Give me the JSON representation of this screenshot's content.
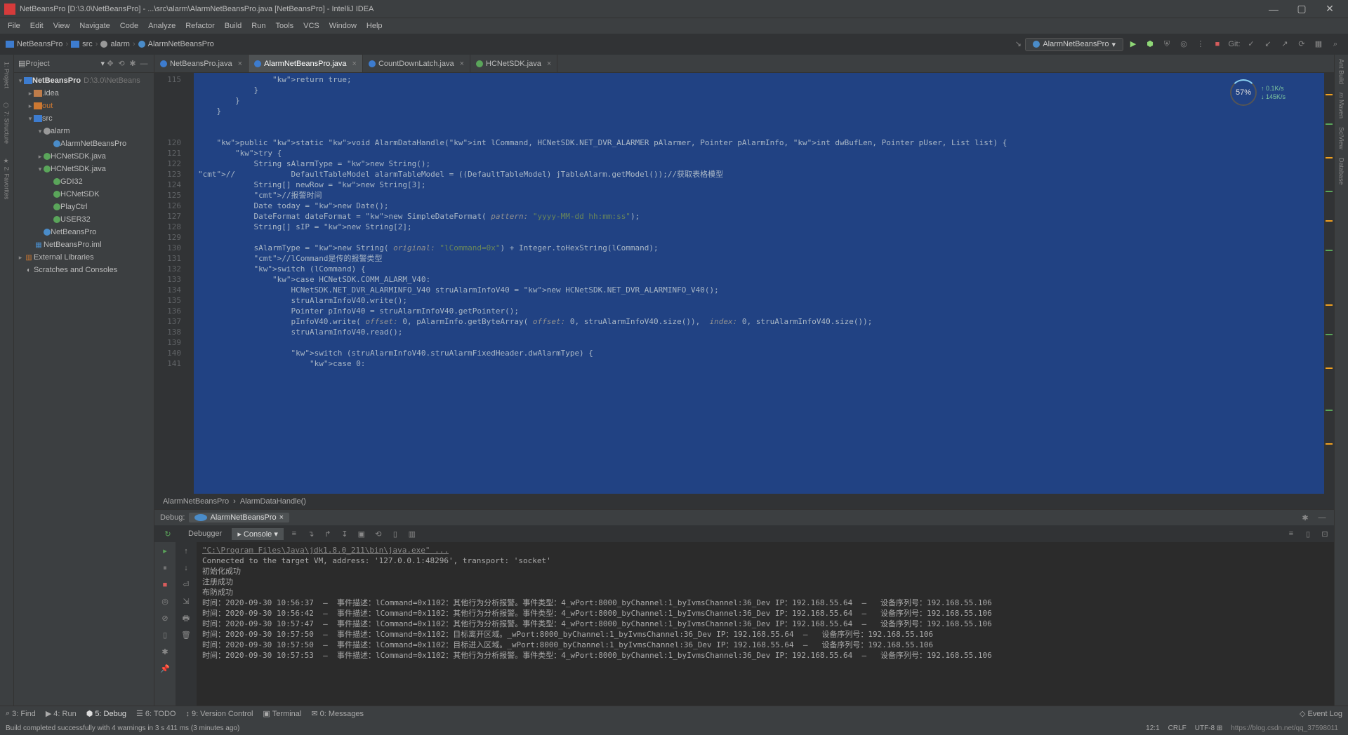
{
  "window": {
    "title": "NetBeansPro [D:\\3.0\\NetBeansPro] - ...\\src\\alarm\\AlarmNetBeansPro.java [NetBeansPro] - IntelliJ IDEA"
  },
  "menu": [
    "File",
    "Edit",
    "View",
    "Navigate",
    "Code",
    "Analyze",
    "Refactor",
    "Build",
    "Run",
    "Tools",
    "VCS",
    "Window",
    "Help"
  ],
  "breadcrumbs": [
    "NetBeansPro",
    "src",
    "alarm",
    "AlarmNetBeansPro"
  ],
  "runConfig": "AlarmNetBeansPro",
  "gitLabel": "Git:",
  "projectPanel": {
    "title": "Project"
  },
  "tree": {
    "root": {
      "name": "NetBeansPro",
      "path": "D:\\3.0\\NetBeans"
    },
    "idea": ".idea",
    "out": "out",
    "src": "src",
    "alarm": "alarm",
    "alarmNB": "AlarmNetBeansPro",
    "hcJava": "HCNetSDK.java",
    "hcJava2": "HCNetSDK.java",
    "gdi": "GDI32",
    "hc": "HCNetSDK",
    "play": "PlayCtrl",
    "user": "USER32",
    "nbp": "NetBeansPro",
    "iml": "NetBeansPro.iml",
    "ext": "External Libraries",
    "scratch": "Scratches and Consoles"
  },
  "tabs": [
    {
      "name": "NetBeansPro.java",
      "kind": "cls"
    },
    {
      "name": "AlarmNetBeansPro.java",
      "kind": "cls",
      "active": true
    },
    {
      "name": "CountDownLatch.java",
      "kind": "cls"
    },
    {
      "name": "HCNetSDK.java",
      "kind": "int"
    }
  ],
  "rightTools": [
    "Ant Build",
    "Maven",
    "SciView",
    "Database"
  ],
  "gauge": {
    "pct": "57%",
    "up": "0.1K/s",
    "down": "145K/s"
  },
  "gutter": [
    "115",
    "",
    "",
    "",
    "",
    "",
    "120",
    "121",
    "122",
    "123",
    "124",
    "125",
    "126",
    "127",
    "128",
    "129",
    "130",
    "131",
    "132",
    "133",
    "134",
    "135",
    "136",
    "137",
    "138",
    "139",
    "140",
    "141"
  ],
  "code": [
    "                return true;",
    "            }",
    "        }",
    "    }",
    "",
    "",
    "    public static void AlarmDataHandle(int lCommand, HCNetSDK.NET_DVR_ALARMER pAlarmer, Pointer pAlarmInfo, int dwBufLen, Pointer pUser, List<String[]> list) {",
    "        try {",
    "            String sAlarmType = new String();",
    "//            DefaultTableModel alarmTableModel = ((DefaultTableModel) jTableAlarm.getModel());//获取表格模型",
    "            String[] newRow = new String[3];",
    "            //报警时间",
    "            Date today = new Date();",
    "            DateFormat dateFormat = new SimpleDateFormat( pattern: \"yyyy-MM-dd hh:mm:ss\");",
    "            String[] sIP = new String[2];",
    "",
    "            sAlarmType = new String( original: \"lCommand=0x\") + Integer.toHexString(lCommand);",
    "            //lCommand是传的报警类型",
    "            switch (lCommand) {",
    "                case HCNetSDK.COMM_ALARM_V40:",
    "                    HCNetSDK.NET_DVR_ALARMINFO_V40 struAlarmInfoV40 = new HCNetSDK.NET_DVR_ALARMINFO_V40();",
    "                    struAlarmInfoV40.write();",
    "                    Pointer pInfoV40 = struAlarmInfoV40.getPointer();",
    "                    pInfoV40.write( offset: 0, pAlarmInfo.getByteArray( offset: 0, struAlarmInfoV40.size()),  index: 0, struAlarmInfoV40.size());",
    "                    struAlarmInfoV40.read();",
    "",
    "                    switch (struAlarmInfoV40.struAlarmFixedHeader.dwAlarmType) {",
    "                        case 0:"
  ],
  "editorBreadcrumb": [
    "AlarmNetBeansPro",
    "AlarmDataHandle()"
  ],
  "debug": {
    "label": "Debug:",
    "tab": "AlarmNetBeansPro",
    "tabs": [
      "Debugger",
      "Console"
    ],
    "activeTab": "Console"
  },
  "console": [
    "\"C:\\Program Files\\Java\\jdk1.8.0_211\\bin\\java.exe\" ...",
    "Connected to the target VM, address: '127.0.0.1:48296', transport: 'socket'",
    "初始化成功",
    "注册成功",
    "布防成功",
    "时间：2020-09-30 10:56:37  —  事件描述：lCommand=0x1102：其他行为分析报警。事件类型：4_wPort:8000_byChannel:1_byIvmsChannel:36_Dev IP：192.168.55.64  —   设备序列号：192.168.55.106",
    "时间：2020-09-30 10:56:42  —  事件描述：lCommand=0x1102：其他行为分析报警。事件类型：4_wPort:8000_byChannel:1_byIvmsChannel:36_Dev IP：192.168.55.64  —   设备序列号：192.168.55.106",
    "时间：2020-09-30 10:57:47  —  事件描述：lCommand=0x1102：其他行为分析报警。事件类型：4_wPort:8000_byChannel:1_byIvmsChannel:36_Dev IP：192.168.55.64  —   设备序列号：192.168.55.106",
    "时间：2020-09-30 10:57:50  —  事件描述：lCommand=0x1102：目标离开区域。_wPort:8000_byChannel:1_byIvmsChannel:36_Dev IP：192.168.55.64  —   设备序列号：192.168.55.106",
    "时间：2020-09-30 10:57:50  —  事件描述：lCommand=0x1102：目标进入区域。_wPort:8000_byChannel:1_byIvmsChannel:36_Dev IP：192.168.55.64  —   设备序列号：192.168.55.106",
    "时间：2020-09-30 10:57:53  —  事件描述：lCommand=0x1102：其他行为分析报警。事件类型：4_wPort:8000_byChannel:1_byIvmsChannel:36_Dev IP：192.168.55.64  —   设备序列号：192.168.55.106"
  ],
  "bottomTools": [
    "3: Find",
    "4: Run",
    "5: Debug",
    "6: TODO",
    "9: Version Control",
    "Terminal",
    "0: Messages"
  ],
  "eventLog": "Event Log",
  "status": {
    "msg": "Build completed successfully with 4 warnings in 3 s 411 ms (3 minutes ago)",
    "pos": "12:1",
    "eol": "CRLF",
    "enc": "UTF-8",
    "watermark": "https://blog.csdn.net/qq_37598011"
  }
}
